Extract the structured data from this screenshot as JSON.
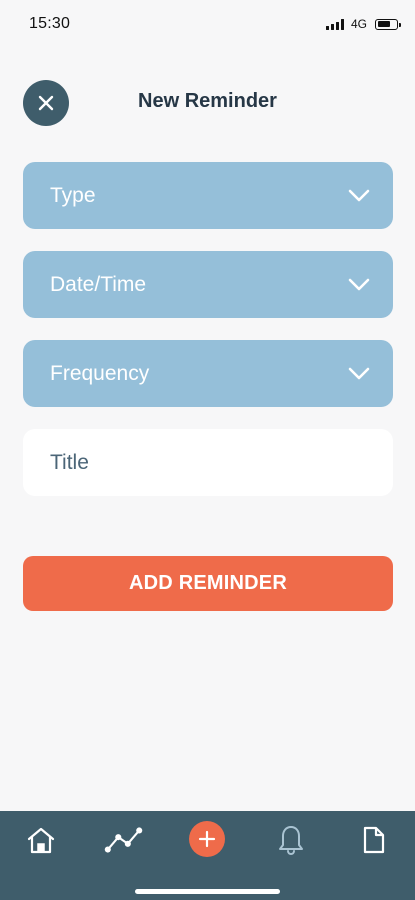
{
  "status_bar": {
    "time": "15:30",
    "network": "4G",
    "battery_level": 0.72
  },
  "header": {
    "close_icon": "close-icon",
    "title": "New Reminder"
  },
  "form": {
    "type_label": "Type",
    "datetime_label": "Date/Time",
    "frequency_label": "Frequency",
    "title_placeholder": "Title",
    "title_value": "",
    "submit_label": "ADD REMINDER"
  },
  "tab_bar": {
    "items": [
      {
        "icon": "home-icon"
      },
      {
        "icon": "chart-line-icon"
      },
      {
        "icon": "plus-icon"
      },
      {
        "icon": "bell-icon"
      },
      {
        "icon": "document-icon"
      }
    ]
  },
  "colors": {
    "accent": "#ef6b4a",
    "primary_dark": "#3f5d6b",
    "field_blue": "#95bfd9",
    "background": "#f7f7f8"
  }
}
